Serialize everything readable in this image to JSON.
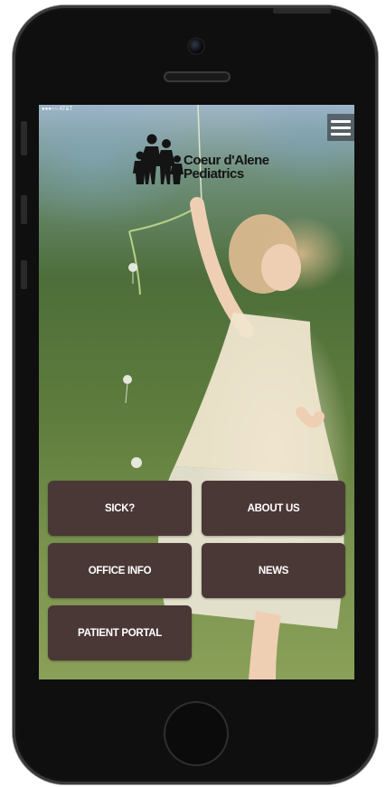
{
  "status_bar": {
    "carrier": "●●●○○ AT&T"
  },
  "header": {
    "logo": {
      "line1": "Coeur d'Alene",
      "line2": "Pediatrics"
    },
    "menu_icon": "hamburger-menu-icon"
  },
  "buttons": [
    {
      "label": "SICK?"
    },
    {
      "label": "ABOUT US"
    },
    {
      "label": "OFFICE INFO"
    },
    {
      "label": "NEWS"
    },
    {
      "label": "PATIENT PORTAL"
    }
  ],
  "colors": {
    "button_bg": "#4a3836",
    "button_text": "#ffffff"
  }
}
